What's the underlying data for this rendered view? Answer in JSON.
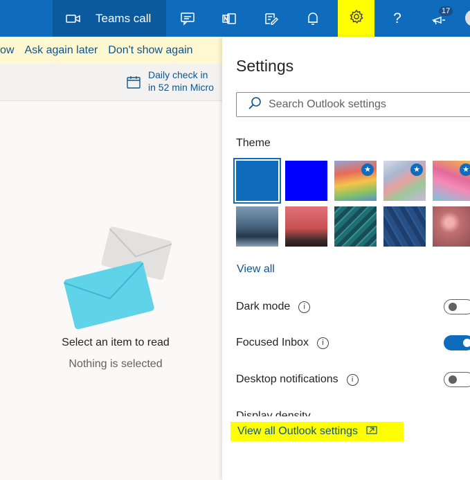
{
  "topbar": {
    "teams_call_label": "Teams call",
    "icons": [
      "video-icon",
      "chat-icon",
      "onenote-icon",
      "todo-icon",
      "bell-icon",
      "gear-icon",
      "help-icon",
      "feedback-icon"
    ],
    "help_glyph": "?",
    "badge_count": "17",
    "highlight_color": "#ffff00"
  },
  "notice": {
    "links": [
      "ow",
      "Ask again later",
      "Don't show again"
    ]
  },
  "checkin": {
    "title": "Daily check in",
    "subtitle": "in 52 min Micro"
  },
  "reading_pane": {
    "empty_title": "Select an item to read",
    "empty_subtitle": "Nothing is selected"
  },
  "settings": {
    "title": "Settings",
    "search_placeholder": "Search Outlook settings",
    "theme_label": "Theme",
    "themes": [
      {
        "name": "blue",
        "color": "#0f6cbd",
        "selected": true,
        "starred": false
      },
      {
        "name": "bright-blue",
        "color": "#0000ff",
        "selected": false,
        "starred": false
      },
      {
        "name": "rainbow-stripes",
        "color": "#e8b84a",
        "selected": false,
        "starred": true
      },
      {
        "name": "rainbow-waves",
        "color": "#b7c2d8",
        "selected": false,
        "starred": true
      },
      {
        "name": "pride-unicorn",
        "color": "#e07aa8",
        "selected": false,
        "starred": true
      },
      {
        "name": "mountain",
        "color": "#4a6a86",
        "selected": false,
        "starred": false
      },
      {
        "name": "palms",
        "color": "#c85a5a",
        "selected": false,
        "starred": false
      },
      {
        "name": "circuit",
        "color": "#1f6e73",
        "selected": false,
        "starred": false
      },
      {
        "name": "navigation",
        "color": "#274f86",
        "selected": false,
        "starred": false
      },
      {
        "name": "bokeh",
        "color": "#b06a6a",
        "selected": false,
        "starred": false
      }
    ],
    "star_glyph": "★",
    "view_all_label": "View all",
    "options": [
      {
        "label": "Dark mode",
        "on": false
      },
      {
        "label": "Focused Inbox",
        "on": true
      },
      {
        "label": "Desktop notifications",
        "on": false
      }
    ],
    "info_glyph": "i",
    "cut_off_label": "Display density",
    "footer_link_label": "View all Outlook settings"
  }
}
